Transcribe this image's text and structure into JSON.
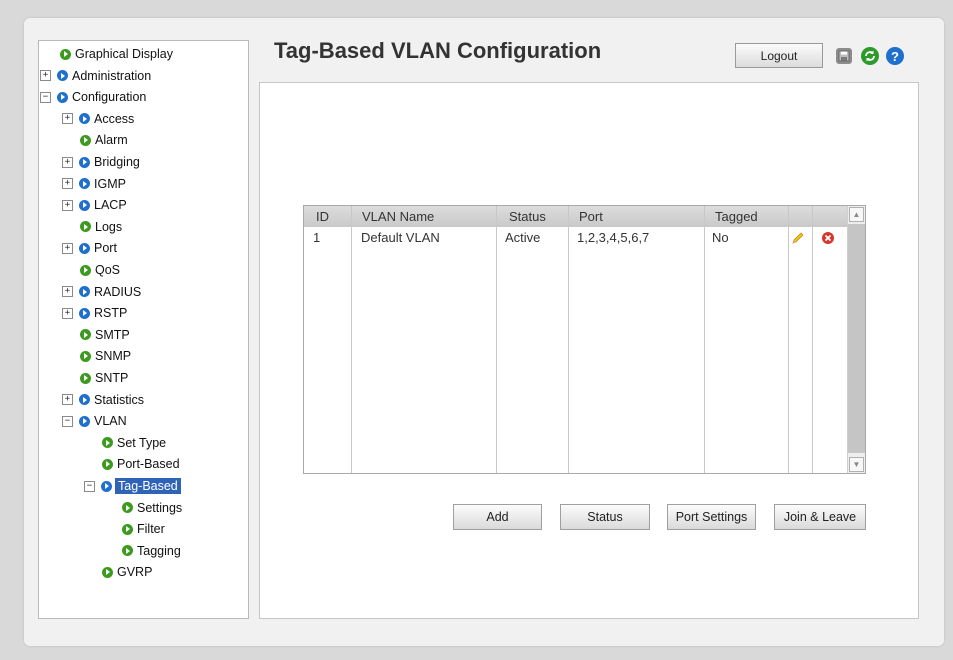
{
  "header": {
    "title": "Tag-Based VLAN Configuration",
    "logout_label": "Logout",
    "icons": [
      "save-icon",
      "refresh-icon",
      "help-icon"
    ]
  },
  "tree": [
    {
      "label": "Graphical Display",
      "toggle": "",
      "color": "green"
    },
    {
      "label": "Administration",
      "toggle": "+",
      "color": "blue"
    },
    {
      "label": "Configuration",
      "toggle": "−",
      "color": "blue"
    },
    {
      "label": "Access",
      "toggle": "+",
      "color": "blue"
    },
    {
      "label": "Alarm",
      "toggle": "",
      "color": "green"
    },
    {
      "label": "Bridging",
      "toggle": "+",
      "color": "blue"
    },
    {
      "label": "IGMP",
      "toggle": "+",
      "color": "blue"
    },
    {
      "label": "LACP",
      "toggle": "+",
      "color": "blue"
    },
    {
      "label": "Logs",
      "toggle": "",
      "color": "green"
    },
    {
      "label": "Port",
      "toggle": "+",
      "color": "blue"
    },
    {
      "label": "QoS",
      "toggle": "",
      "color": "green"
    },
    {
      "label": "RADIUS",
      "toggle": "+",
      "color": "blue"
    },
    {
      "label": "RSTP",
      "toggle": "+",
      "color": "blue"
    },
    {
      "label": "SMTP",
      "toggle": "",
      "color": "green"
    },
    {
      "label": "SNMP",
      "toggle": "",
      "color": "green"
    },
    {
      "label": "SNTP",
      "toggle": "",
      "color": "green"
    },
    {
      "label": "Statistics",
      "toggle": "+",
      "color": "blue"
    },
    {
      "label": "VLAN",
      "toggle": "−",
      "color": "blue"
    },
    {
      "label": "Set Type",
      "toggle": "",
      "color": "green"
    },
    {
      "label": "Port-Based",
      "toggle": "",
      "color": "green"
    },
    {
      "label": "Tag-Based",
      "toggle": "−",
      "color": "blue",
      "selected": true
    },
    {
      "label": "Settings",
      "toggle": "",
      "color": "green"
    },
    {
      "label": "Filter",
      "toggle": "",
      "color": "green"
    },
    {
      "label": "Tagging",
      "toggle": "",
      "color": "green"
    },
    {
      "label": "GVRP",
      "toggle": "",
      "color": "green"
    }
  ],
  "table": {
    "columns": [
      "ID",
      "VLAN Name",
      "Status",
      "Port",
      "Tagged"
    ],
    "rows": [
      {
        "id": "1",
        "name": "Default VLAN",
        "status": "Active",
        "port": "1,2,3,4,5,6,7",
        "tagged": "No",
        "actions": [
          "edit-icon",
          "delete-icon"
        ]
      }
    ]
  },
  "buttons": {
    "add": "Add",
    "status": "Status",
    "port_settings": "Port Settings",
    "join_leave": "Join & Leave"
  },
  "colors": {
    "selected": "#2f63b8",
    "bullet_green": "#3d9a1e",
    "bullet_blue": "#1f6fcf"
  }
}
